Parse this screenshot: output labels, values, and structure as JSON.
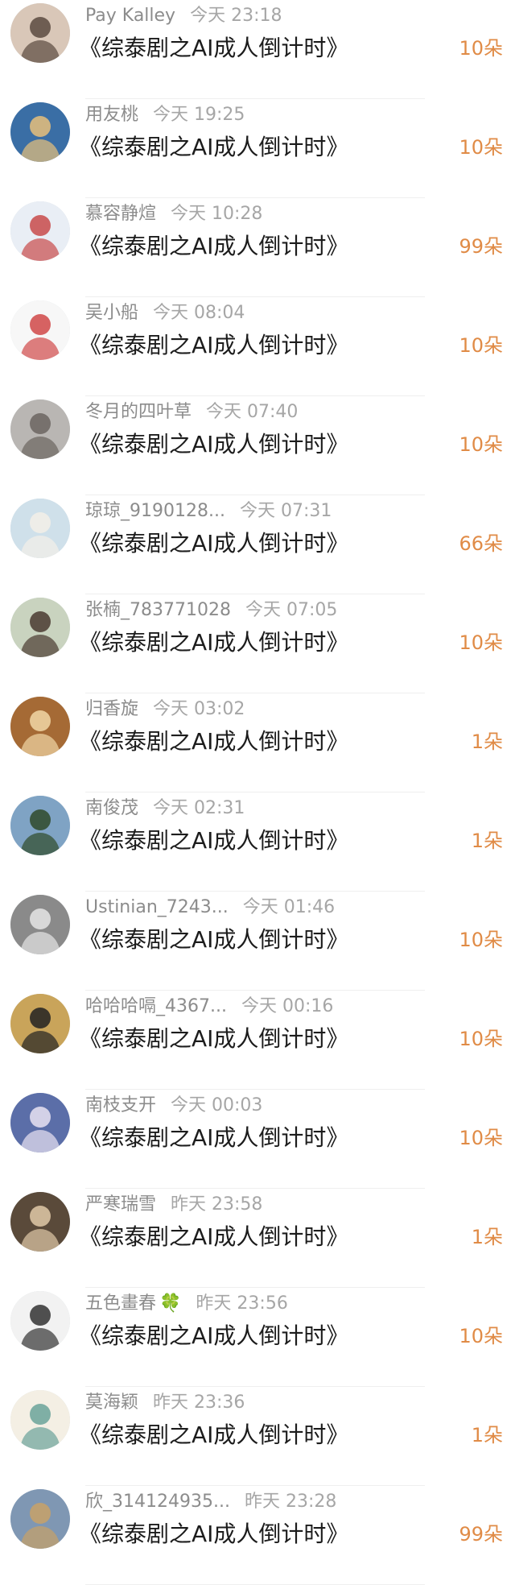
{
  "items": [
    {
      "name": "Pay Kalley",
      "time": "今天 23:18",
      "title": "《综泰剧之AI成人倒计时》",
      "amount": "10朵",
      "avatar_bg": "#d9c7b8",
      "avatar_fg": "#5a4a3f",
      "avatar_icon": "woman-portrait-icon"
    },
    {
      "name": "用友桃",
      "time": "今天 19:25",
      "title": "《综泰剧之AI成人倒计时》",
      "amount": "10朵",
      "avatar_bg": "#3a6ea5",
      "avatar_fg": "#e8c07a",
      "avatar_icon": "landscape-icon"
    },
    {
      "name": "慕容静煊",
      "time": "今天 10:28",
      "title": "《综泰剧之AI成人倒计时》",
      "amount": "99朵",
      "avatar_bg": "#e9eef5",
      "avatar_fg": "#c84a4a",
      "avatar_icon": "girl-illustration-icon"
    },
    {
      "name": "吴小船",
      "time": "今天 08:04",
      "title": "《综泰剧之AI成人倒计时》",
      "amount": "10朵",
      "avatar_bg": "#f7f7f7",
      "avatar_fg": "#d04848",
      "avatar_icon": "cartoon-character-icon"
    },
    {
      "name": "冬月的四叶草",
      "time": "今天 07:40",
      "title": "《综泰剧之AI成人倒计时》",
      "amount": "10朵",
      "avatar_bg": "#b9b6b3",
      "avatar_fg": "#6b6560",
      "avatar_icon": "cat-icon"
    },
    {
      "name": "琼琼_9190128...",
      "time": "今天 07:31",
      "title": "《综泰剧之AI成人倒计时》",
      "amount": "66朵",
      "avatar_bg": "#cfe0ea",
      "avatar_fg": "#f3efe8",
      "avatar_icon": "beach-icon"
    },
    {
      "name": "张楠_783771028",
      "time": "今天 07:05",
      "title": "《综泰剧之AI成人倒计时》",
      "amount": "10朵",
      "avatar_bg": "#c9d3bf",
      "avatar_fg": "#4a3a30",
      "avatar_icon": "person-photo-icon"
    },
    {
      "name": "归香旋",
      "time": "今天 03:02",
      "title": "《综泰剧之AI成人倒计时》",
      "amount": "1朵",
      "avatar_bg": "#a56a35",
      "avatar_fg": "#f1d7a6",
      "avatar_icon": "latte-art-icon"
    },
    {
      "name": "南俊茂",
      "time": "今天 02:31",
      "title": "《综泰剧之AI成人倒计时》",
      "amount": "1朵",
      "avatar_bg": "#7fa3c4",
      "avatar_fg": "#2f4a2a",
      "avatar_icon": "lake-forest-icon"
    },
    {
      "name": "Ustinian_7243...",
      "time": "今天 01:46",
      "title": "《综泰剧之AI成人倒计时》",
      "amount": "10朵",
      "avatar_bg": "#8a8a8a",
      "avatar_fg": "#e5e5e5",
      "avatar_icon": "monochrome-portrait-icon"
    },
    {
      "name": "哈哈哈嗝_4367...",
      "time": "今天 00:16",
      "title": "《综泰剧之AI成人倒计时》",
      "amount": "10朵",
      "avatar_bg": "#c9a45a",
      "avatar_fg": "#222222",
      "avatar_icon": "dog-costume-icon"
    },
    {
      "name": "南枝支开",
      "time": "今天 00:03",
      "title": "《综泰剧之AI成人倒计时》",
      "amount": "10朵",
      "avatar_bg": "#5b6ea8",
      "avatar_fg": "#e9e3f2",
      "avatar_icon": "idol-portrait-icon"
    },
    {
      "name": "严寒瑞雪",
      "time": "昨天 23:58",
      "title": "《综泰剧之AI成人倒计时》",
      "amount": "1朵",
      "avatar_bg": "#5a4a3a",
      "avatar_fg": "#e0c9a8",
      "avatar_icon": "group-photo-icon"
    },
    {
      "name": "五色畫春",
      "time": "昨天 23:56",
      "title": "《综泰剧之AI成人倒计时》",
      "amount": "10朵",
      "avatar_bg": "#f2f2f2",
      "avatar_fg": "#333333",
      "avatar_icon": "ink-girl-icon",
      "emoji": "🍀"
    },
    {
      "name": "莫海颖",
      "time": "昨天 23:36",
      "title": "《综泰剧之AI成人倒计时》",
      "amount": "1朵",
      "avatar_bg": "#f4efe4",
      "avatar_fg": "#6aa39a",
      "avatar_icon": "hanfu-girl-icon"
    },
    {
      "name": "欣_314124935...",
      "time": "昨天 23:28",
      "title": "《综泰剧之AI成人倒计时》",
      "amount": "99朵",
      "avatar_bg": "#7f97b3",
      "avatar_fg": "#c8a167",
      "avatar_icon": "temple-sky-icon"
    }
  ],
  "colors": {
    "amount": "#e08b46",
    "name": "#8c8c8c",
    "time": "#a6a6a6",
    "title": "#1c1c1c",
    "divider": "#efefef"
  }
}
